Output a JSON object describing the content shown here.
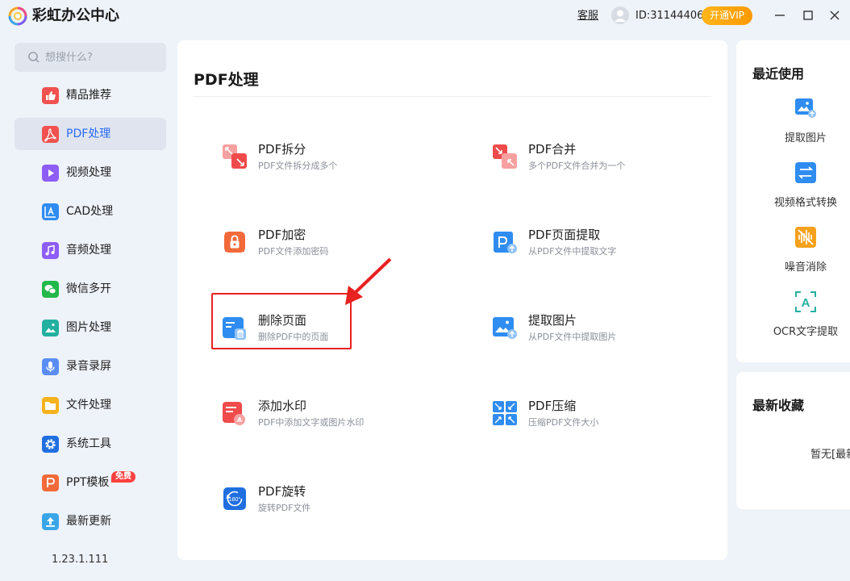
{
  "app": {
    "title": "彩虹办公中心"
  },
  "header": {
    "support_label": "客服",
    "user_id": "ID:31144406",
    "vip_label": "开通VIP"
  },
  "search": {
    "placeholder": "想搜什么?"
  },
  "sidebar": {
    "items": [
      {
        "label": "精品推荐",
        "icon": "thumbs-up-icon",
        "color": "#f0524f"
      },
      {
        "label": "PDF处理",
        "icon": "pdf-icon",
        "color": "#f0524f"
      },
      {
        "label": "视频处理",
        "icon": "play-icon",
        "color": "#8e5cf6"
      },
      {
        "label": "CAD处理",
        "icon": "cad-icon",
        "color": "#2f8cf0"
      },
      {
        "label": "音频处理",
        "icon": "music-icon",
        "color": "#8e5cf6"
      },
      {
        "label": "微信多开",
        "icon": "wechat-icon",
        "color": "#22b84a"
      },
      {
        "label": "图片处理",
        "icon": "image-icon",
        "color": "#22b0a0"
      },
      {
        "label": "录音录屏",
        "icon": "microphone-icon",
        "color": "#5a8df4"
      },
      {
        "label": "文件处理",
        "icon": "folder-icon",
        "color": "#f5b21c"
      },
      {
        "label": "系统工具",
        "icon": "gear-icon",
        "color": "#1f6fe0"
      },
      {
        "label": "PPT模板",
        "icon": "ppt-icon",
        "color": "#f26a3a",
        "badge": "免费"
      },
      {
        "label": "最新更新",
        "icon": "upload-icon",
        "color": "#3aa6e8"
      }
    ],
    "version": "1.23.1.111"
  },
  "main": {
    "title": "PDF处理",
    "tools": [
      {
        "name": "PDF拆分",
        "desc": "PDF文件拆分成多个",
        "icon": "pdf-split-icon"
      },
      {
        "name": "PDF合并",
        "desc": "多个PDF文件合并为一个",
        "icon": "pdf-merge-icon"
      },
      {
        "name": "PDF加密",
        "desc": "PDF文件添加密码",
        "icon": "pdf-lock-icon"
      },
      {
        "name": "PDF页面提取",
        "desc": "从PDF文件中提取文字",
        "icon": "pdf-extract-page-icon"
      },
      {
        "name": "删除页面",
        "desc": "删除PDF中的页面",
        "icon": "delete-page-icon"
      },
      {
        "name": "提取图片",
        "desc": "从PDF文件中提取图片",
        "icon": "extract-image-icon"
      },
      {
        "name": "添加水印",
        "desc": "PDF中添加文字或图片水印",
        "icon": "watermark-icon"
      },
      {
        "name": "PDF压缩",
        "desc": "压缩PDF文件大小",
        "icon": "pdf-compress-icon"
      },
      {
        "name": "PDF旋转",
        "desc": "旋转PDF文件",
        "icon": "pdf-rotate-icon"
      }
    ]
  },
  "recent": {
    "title": "最近使用",
    "items": [
      {
        "label": "提取图片",
        "icon": "extract-image-icon"
      },
      {
        "label": "视频格式转换",
        "icon": "video-convert-icon"
      },
      {
        "label": "噪音消除",
        "icon": "noise-reduction-icon"
      },
      {
        "label": "OCR文字提取",
        "icon": "ocr-icon"
      }
    ]
  },
  "favorites": {
    "title": "最新收藏",
    "empty_text": "暂无[最新收藏]"
  },
  "colors": {
    "accent": "#2a6cf6",
    "vip": "#ff9900",
    "highlight": "#e82121",
    "background": "#eef2f9"
  }
}
